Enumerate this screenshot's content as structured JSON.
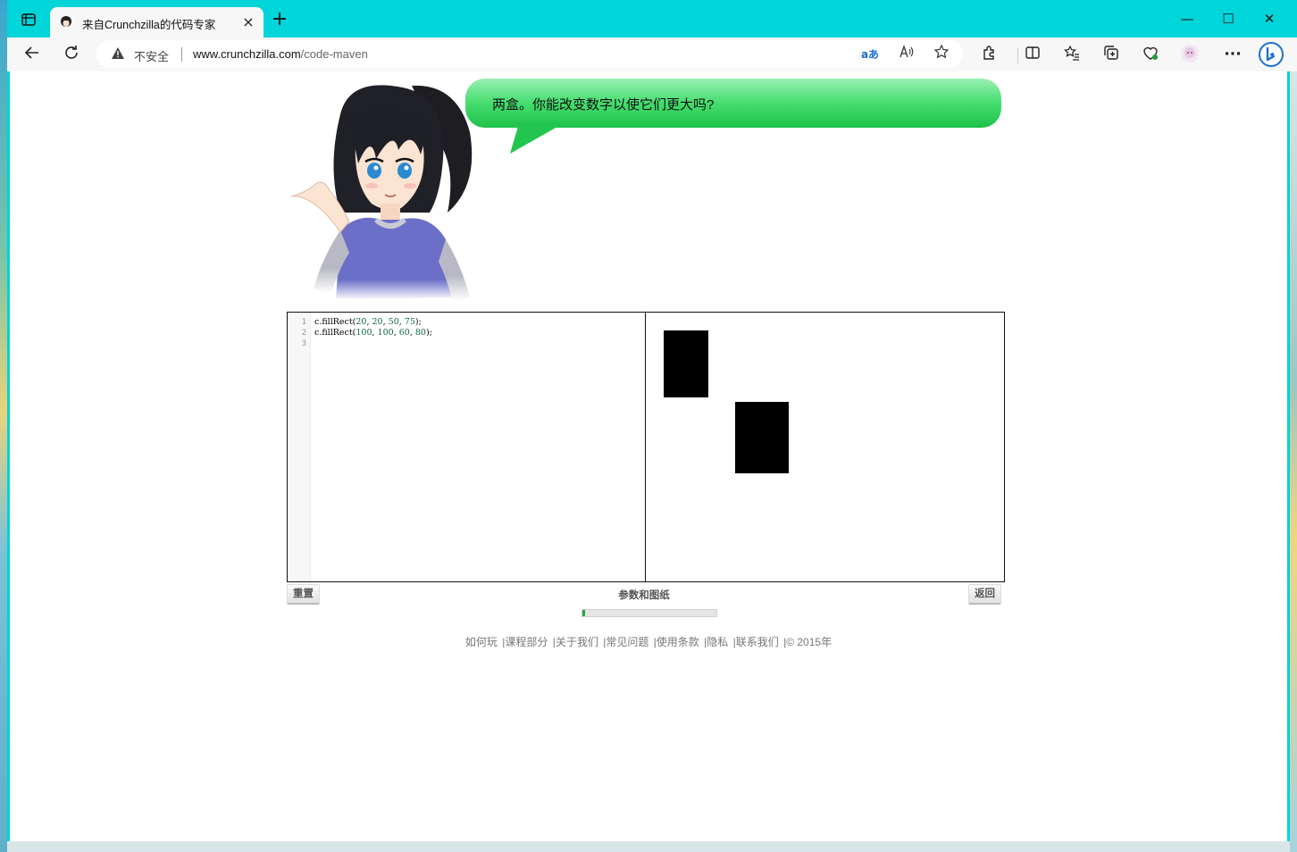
{
  "browser": {
    "tab": {
      "title": "来自Crunchzilla的代码专家",
      "close": "×"
    },
    "new_tab": "+",
    "window_controls": {
      "minimize": "—",
      "maximize": "☐",
      "close": "✕"
    },
    "security": "不安全",
    "url_host": "www.crunchzilla.com",
    "url_path": "/code-maven",
    "more": "···",
    "icons": [
      "tab-actions-icon",
      "back-icon",
      "refresh-icon",
      "warning-icon",
      "translate-icon",
      "read-aloud-icon",
      "favorite-star-icon",
      "extensions-icon",
      "split-screen-icon",
      "favorites-icon",
      "collections-icon",
      "performance-icon",
      "profile-avatar-icon",
      "more-icon",
      "bing-icon"
    ]
  },
  "lesson": {
    "speech": "两盒。你能改变数字以使它们更大吗?"
  },
  "editor": {
    "line_numbers": [
      "1",
      "2",
      "3"
    ],
    "lines": [
      {
        "prefix": "c.fillRect(",
        "args": [
          "20",
          "20",
          "50",
          "75"
        ],
        "suffix": ");"
      },
      {
        "prefix": "c.fillRect(",
        "args": [
          "100",
          "100",
          "60",
          "80"
        ],
        "suffix": ");"
      },
      {
        "prefix": "",
        "args": [],
        "suffix": ""
      }
    ]
  },
  "controls": {
    "reset": "重置",
    "center": "参数和图纸",
    "back": "返回",
    "progress": 0.02
  },
  "footer": {
    "links": [
      "如何玩",
      "|课程部分",
      "|关于我们",
      "|常见问题",
      "|使用条款",
      "|隐私",
      "|联系我们",
      "|© 2015年"
    ]
  },
  "colors": {
    "titlebar": "#00d5da",
    "bubble": "#2fd65a",
    "progress": "#28a745"
  }
}
